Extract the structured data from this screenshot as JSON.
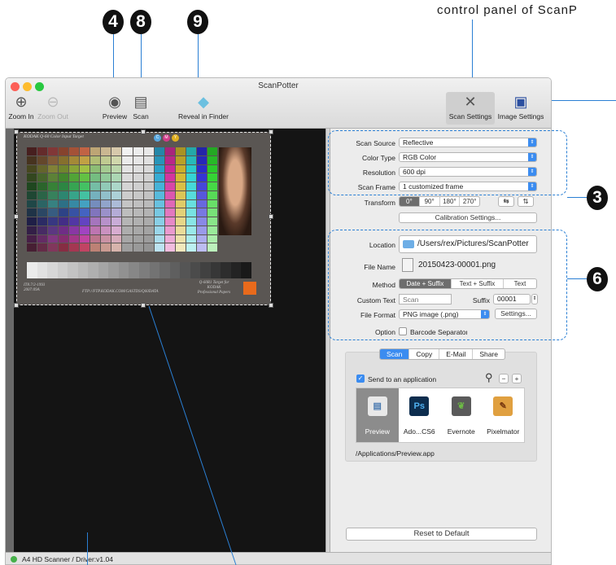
{
  "callouts": {
    "c4": "4",
    "c8": "8",
    "c9": "9",
    "c3": "3",
    "c6": "6"
  },
  "caption": "control panel of ScanP",
  "window": {
    "title": "ScanPotter"
  },
  "toolbar": {
    "zoom_in": "Zoom In",
    "zoom_out": "Zoom Out",
    "preview": "Preview",
    "scan": "Scan",
    "reveal": "Reveal in Finder",
    "scan_settings": "Scan Settings",
    "image_settings": "Image Settings"
  },
  "target": {
    "header": "KODAK Q-60 Color Input Target",
    "footer_left1": "IT8.7/2-1993",
    "footer_left2": "2007:09A",
    "footer_mid": "FTP://FTP.KODAK.COM/GASTDS/Q60DATA",
    "footer_right1": "Q-60R1 Target for",
    "footer_right2": "KODAK",
    "footer_right3": "Professional Papers",
    "chips": [
      "C",
      "M",
      "Y"
    ]
  },
  "status": {
    "text": "A4 HD Scanner / Driver:v1.04"
  },
  "settings": {
    "scan_source": {
      "label": "Scan Source",
      "value": "Reflective"
    },
    "color_type": {
      "label": "Color Type",
      "value": "RGB Color"
    },
    "resolution": {
      "label": "Resolution",
      "value": "600 dpi"
    },
    "scan_frame": {
      "label": "Scan Frame",
      "value": "1 customized frame"
    },
    "transform": {
      "label": "Transform",
      "options": [
        "0°",
        "90°",
        "180°",
        "270°"
      ]
    },
    "calibration": "Calibration Settings..."
  },
  "output": {
    "location": {
      "label": "Location",
      "value": "/Users/rex/Pictures/ScanPotter"
    },
    "file_name": {
      "label": "File Name",
      "value": "20150423-00001.png"
    },
    "method": {
      "label": "Method",
      "options": [
        "Date + Suffix",
        "Text + Suffix",
        "Text"
      ]
    },
    "custom_text": {
      "label": "Custom Text",
      "placeholder": "Scan"
    },
    "suffix": {
      "label": "Suffix",
      "value": "00001"
    },
    "file_format": {
      "label": "File Format",
      "value": "PNG image (.png)",
      "settings": "Settings..."
    },
    "option": {
      "label": "Option",
      "value": "Barcode Separator"
    }
  },
  "dest": {
    "tabs": [
      "Scan",
      "Copy",
      "E-Mail",
      "Share"
    ],
    "send_label": "Send to an application",
    "apps": [
      {
        "name": "Preview"
      },
      {
        "name": "Ado...CS6"
      },
      {
        "name": "Evernote"
      },
      {
        "name": "Pixelmator"
      }
    ],
    "path": "/Applications/Preview.app"
  },
  "reset": "Reset to Default",
  "colors": {
    "accent": "#3b8cf0",
    "callout": "#111111",
    "pointer": "#2a7fd4"
  }
}
